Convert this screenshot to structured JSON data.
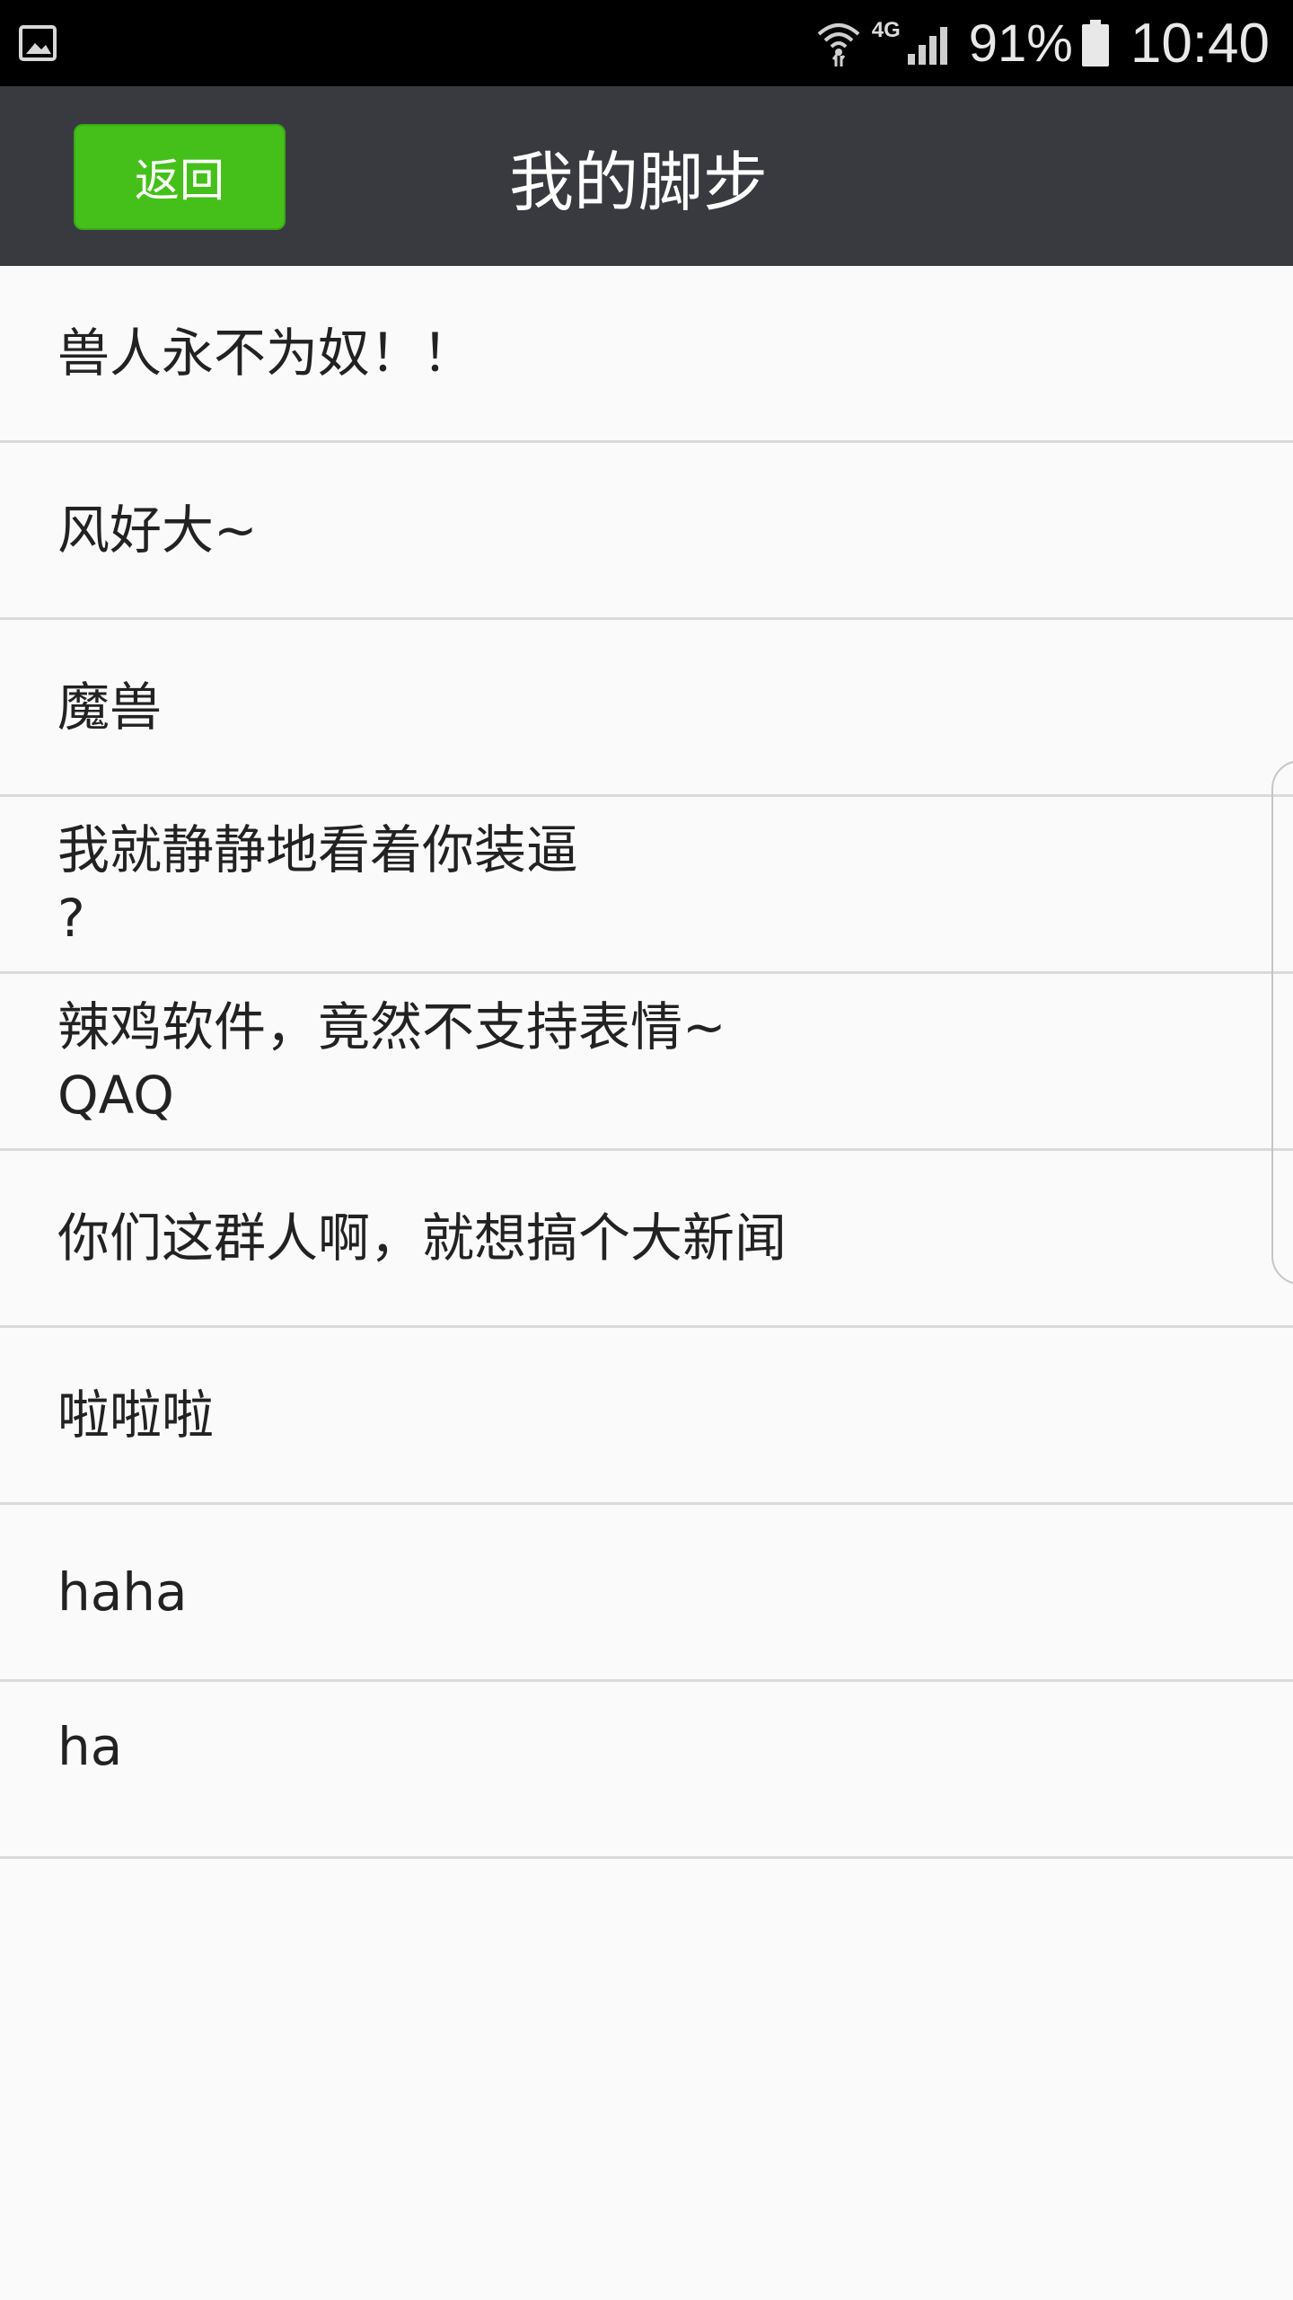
{
  "status_bar": {
    "network_type": "4G",
    "battery_percent": "91%",
    "time": "10:40",
    "icons": [
      "gallery-icon",
      "wifi-icon",
      "signal-icon",
      "battery-icon"
    ]
  },
  "header": {
    "back_label": "返回",
    "title": "我的脚步",
    "background_color": "#393a3f",
    "back_button_color": "#45c01a"
  },
  "list": {
    "items": [
      {
        "text": "兽人永不为奴！！"
      },
      {
        "text": "风好大~"
      },
      {
        "text": "魔兽"
      },
      {
        "text": "我就静静地看着你装逼\n?"
      },
      {
        "text": "辣鸡软件，竟然不支持表情~\nQAQ"
      },
      {
        "text": "你们这群人啊，就想搞个大新闻"
      },
      {
        "text": "啦啦啦"
      },
      {
        "text": "haha"
      },
      {
        "text": "ha"
      }
    ]
  }
}
